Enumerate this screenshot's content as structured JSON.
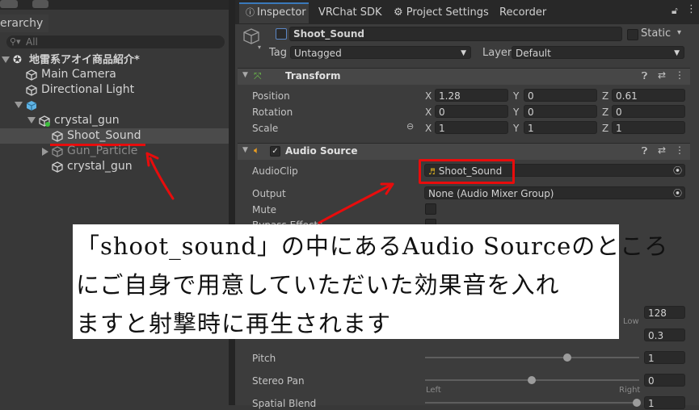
{
  "hierarchy": {
    "tab_label": "erarchy",
    "search_placeholder": "All",
    "scene_name": "地雷系アオイ商品紹介*",
    "items": [
      {
        "label": "Main Camera"
      },
      {
        "label": "Directional Light"
      },
      {
        "label": ""
      },
      {
        "label": "crystal_gun"
      },
      {
        "label": "Shoot_Sound"
      },
      {
        "label": "Gun_Particle"
      },
      {
        "label": "crystal_gun"
      }
    ]
  },
  "tabs": [
    "Inspector",
    "VRChat SDK",
    "Project Settings",
    "Recorder"
  ],
  "object": {
    "name": "Shoot_Sound",
    "static_label": "Static",
    "tag_label": "Tag",
    "tag_value": "Untagged",
    "layer_label": "Layer",
    "layer_value": "Default"
  },
  "transform": {
    "title": "Transform",
    "position_label": "Position",
    "rotation_label": "Rotation",
    "scale_label": "Scale",
    "position": {
      "x": "1.28",
      "y": "0",
      "z": "0.61"
    },
    "rotation": {
      "x": "0",
      "y": "0",
      "z": "0"
    },
    "scale": {
      "x": "1",
      "y": "1",
      "z": "1"
    },
    "axis_x": "X",
    "axis_y": "Y",
    "axis_z": "Z"
  },
  "audio_source": {
    "title": "Audio Source",
    "audioclip_label": "AudioClip",
    "audioclip_value": "Shoot_Sound",
    "output_label": "Output",
    "output_value": "None (Audio Mixer Group)",
    "mute_label": "Mute",
    "bypass_label": "Bypass Effects",
    "priority_value": "128",
    "low_label": "Low",
    "volume_value": "0.3",
    "pitch_label": "Pitch",
    "pitch_value": "1",
    "stereo_label": "Stereo Pan",
    "stereo_value": "0",
    "left_label": "Left",
    "right_label": "Right",
    "spatial_label": "Spatial Blend",
    "spatial_value": "1"
  },
  "caption": {
    "line1": "「shoot_sound」の中にあるAudio Sourceのところ",
    "line2": "にご自身で用意していただいた効果音を入れ",
    "line3": "ますと射撃時に再生されます"
  },
  "colors": {
    "annotation": "#e80c0c",
    "accent": "#3a79bb"
  }
}
